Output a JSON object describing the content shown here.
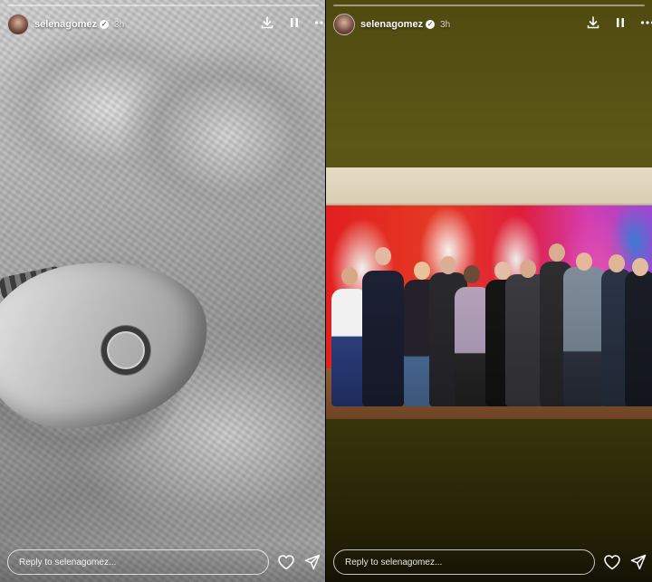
{
  "stories": [
    {
      "username": "selenagomez",
      "time_ago": "3h",
      "reply_placeholder": "Reply to selenagomez...",
      "icons": [
        "download-icon",
        "pause-icon",
        "more-icon",
        "heart-icon",
        "send-icon"
      ]
    },
    {
      "username": "selenagomez",
      "time_ago": "3h",
      "reply_placeholder": "Reply to selenagomez...",
      "icons": [
        "download-icon",
        "pause-icon",
        "more-icon",
        "heart-icon",
        "send-icon"
      ]
    }
  ],
  "colors": {
    "background": "#000000",
    "right_story_frame": "#4f4a10",
    "text": "#ffffff"
  }
}
